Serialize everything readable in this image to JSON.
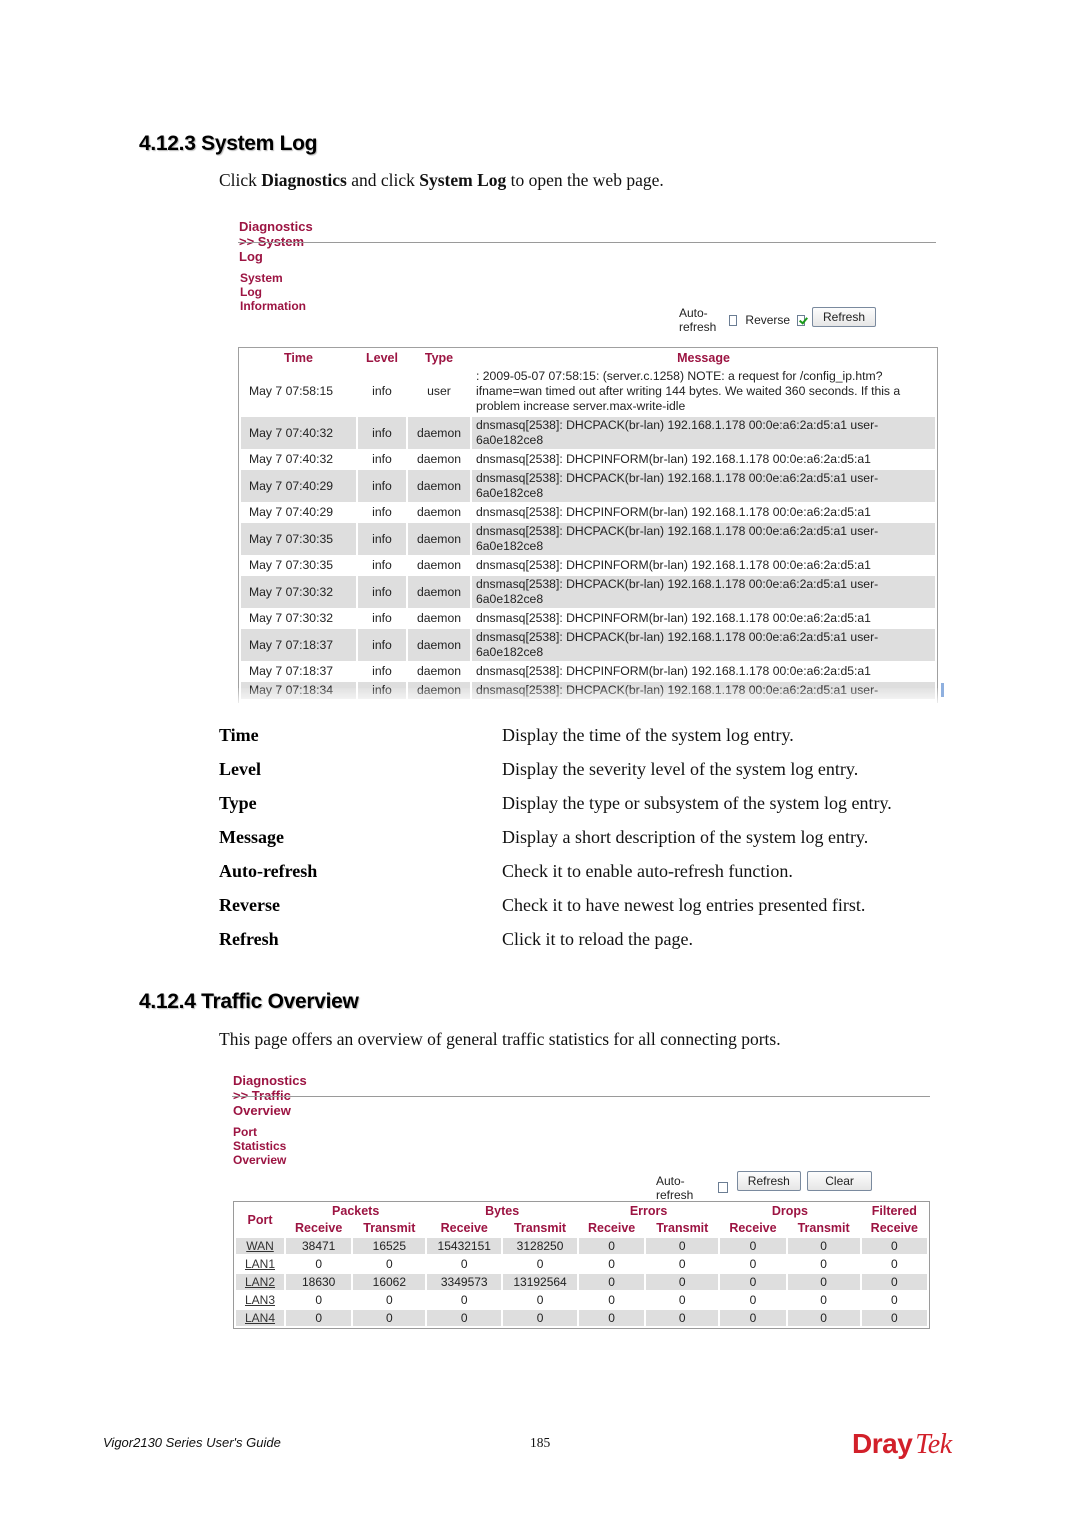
{
  "section1": {
    "heading": "4.12.3 System Log",
    "intro": {
      "prefix": "Click ",
      "bold1": "Diagnostics",
      "middle": " and click ",
      "bold2": "System Log",
      "suffix": " to open the web page."
    },
    "ui": {
      "breadcrumb": "Diagnostics >> System Log",
      "subtitle": "System Log Information",
      "auto_refresh_label": "Auto-refresh",
      "auto_refresh_checked": false,
      "reverse_label": "Reverse",
      "reverse_checked": true,
      "refresh_button": "Refresh",
      "columns": [
        "Time",
        "Level",
        "Type",
        "Message"
      ],
      "rows": [
        {
          "time": "May  7 07:58:15",
          "level": "info",
          "type": "user",
          "message": ": 2009-05-07 07:58:15: (server.c.1258) NOTE: a request for /config_ip.htm?ifname=wan timed out after writing 144 bytes. We waited 360 seconds. If this a problem increase server.max-write-idle"
        },
        {
          "time": "May  7 07:40:32",
          "level": "info",
          "type": "daemon",
          "message": "dnsmasq[2538]: DHCPACK(br-lan) 192.168.1.178 00:0e:a6:2a:d5:a1 user-6a0e182ce8"
        },
        {
          "time": "May  7 07:40:32",
          "level": "info",
          "type": "daemon",
          "message": "dnsmasq[2538]: DHCPINFORM(br-lan) 192.168.1.178 00:0e:a6:2a:d5:a1"
        },
        {
          "time": "May  7 07:40:29",
          "level": "info",
          "type": "daemon",
          "message": "dnsmasq[2538]: DHCPACK(br-lan) 192.168.1.178 00:0e:a6:2a:d5:a1 user-6a0e182ce8"
        },
        {
          "time": "May  7 07:40:29",
          "level": "info",
          "type": "daemon",
          "message": "dnsmasq[2538]: DHCPINFORM(br-lan) 192.168.1.178 00:0e:a6:2a:d5:a1"
        },
        {
          "time": "May  7 07:30:35",
          "level": "info",
          "type": "daemon",
          "message": "dnsmasq[2538]: DHCPACK(br-lan) 192.168.1.178 00:0e:a6:2a:d5:a1 user-6a0e182ce8"
        },
        {
          "time": "May  7 07:30:35",
          "level": "info",
          "type": "daemon",
          "message": "dnsmasq[2538]: DHCPINFORM(br-lan) 192.168.1.178 00:0e:a6:2a:d5:a1"
        },
        {
          "time": "May  7 07:30:32",
          "level": "info",
          "type": "daemon",
          "message": "dnsmasq[2538]: DHCPACK(br-lan) 192.168.1.178 00:0e:a6:2a:d5:a1 user-6a0e182ce8"
        },
        {
          "time": "May  7 07:30:32",
          "level": "info",
          "type": "daemon",
          "message": "dnsmasq[2538]: DHCPINFORM(br-lan) 192.168.1.178 00:0e:a6:2a:d5:a1"
        },
        {
          "time": "May  7 07:18:37",
          "level": "info",
          "type": "daemon",
          "message": "dnsmasq[2538]: DHCPACK(br-lan) 192.168.1.178 00:0e:a6:2a:d5:a1 user-6a0e182ce8"
        },
        {
          "time": "May  7 07:18:37",
          "level": "info",
          "type": "daemon",
          "message": "dnsmasq[2538]: DHCPINFORM(br-lan) 192.168.1.178 00:0e:a6:2a:d5:a1"
        },
        {
          "time": "May  7 07:18:34",
          "level": "info",
          "type": "daemon",
          "message": "dnsmasq[2538]: DHCPACK(br-lan) 192.168.1.178 00:0e:a6:2a:d5:a1 user-"
        }
      ]
    },
    "definitions": [
      {
        "term": "Time",
        "desc": "Display the time of the system log entry."
      },
      {
        "term": "Level",
        "desc": "Display the severity level of the system log entry."
      },
      {
        "term": "Type",
        "desc": "Display the type or subsystem of the system log entry."
      },
      {
        "term": "Message",
        "desc": "Display a short description of the system log entry."
      },
      {
        "term": "Auto-refresh",
        "desc": "Check it to enable auto-refresh function."
      },
      {
        "term": "Reverse",
        "desc": "Check it to have newest log entries presented first."
      },
      {
        "term": "Refresh",
        "desc": "Click it to reload the page."
      }
    ]
  },
  "section2": {
    "heading": "4.12.4 Traffic Overview",
    "intro": "This page offers an overview of general traffic statistics for all connecting ports.",
    "ui": {
      "breadcrumb": "Diagnostics >> Traffic Overview",
      "subtitle": "Port Statistics Overview",
      "auto_refresh_label": "Auto-refresh",
      "auto_refresh_checked": false,
      "refresh_button": "Refresh",
      "clear_button": "Clear",
      "header_groups": [
        "Port",
        "Packets",
        "Bytes",
        "Errors",
        "Drops",
        "Filtered"
      ],
      "sub_headers": [
        "Receive",
        "Transmit",
        "Receive",
        "Transmit",
        "Receive",
        "Transmit",
        "Receive",
        "Transmit",
        "Receive"
      ],
      "rows": [
        {
          "port": "WAN",
          "values": [
            "38471",
            "16525",
            "15432151",
            "3128250",
            "0",
            "0",
            "0",
            "0",
            "0"
          ]
        },
        {
          "port": "LAN1",
          "values": [
            "0",
            "0",
            "0",
            "0",
            "0",
            "0",
            "0",
            "0",
            "0"
          ]
        },
        {
          "port": "LAN2",
          "values": [
            "18630",
            "16062",
            "3349573",
            "13192564",
            "0",
            "0",
            "0",
            "0",
            "0"
          ]
        },
        {
          "port": "LAN3",
          "values": [
            "0",
            "0",
            "0",
            "0",
            "0",
            "0",
            "0",
            "0",
            "0"
          ]
        },
        {
          "port": "LAN4",
          "values": [
            "0",
            "0",
            "0",
            "0",
            "0",
            "0",
            "0",
            "0",
            "0"
          ]
        }
      ]
    }
  },
  "footer": {
    "guide_title": "Vigor2130 Series User's Guide",
    "page_number": "185",
    "logo_part1": "Dray",
    "logo_part2": "Tek",
    "logo_color": "#d2202a"
  },
  "colors": {
    "accent": "#9c1442",
    "row_alt": "#dedede"
  }
}
